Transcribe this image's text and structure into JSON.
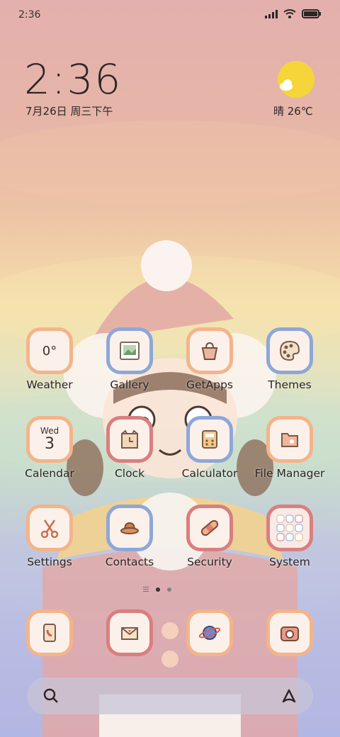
{
  "status_bar": {
    "time": "2:36"
  },
  "clock_widget": {
    "time": "2:36",
    "date": "7月26日 周三下午"
  },
  "weather_widget": {
    "text": "晴 26℃"
  },
  "apps": {
    "weather": {
      "label": "Weather",
      "value": "0°"
    },
    "gallery": {
      "label": "Gallery"
    },
    "getapps": {
      "label": "GetApps"
    },
    "themes": {
      "label": "Themes"
    },
    "calendar": {
      "label": "Calendar",
      "weekday": "Wed",
      "day": "3"
    },
    "clock": {
      "label": "Clock"
    },
    "calculator": {
      "label": "Calculator"
    },
    "file_manager": {
      "label": "File Manager"
    },
    "settings": {
      "label": "Settings"
    },
    "contacts": {
      "label": "Contacts"
    },
    "security": {
      "label": "Security"
    },
    "system": {
      "label": "System"
    }
  },
  "dock": [
    "phone-icon",
    "messages-icon",
    "browser-icon",
    "camera-icon"
  ],
  "page_indicator": {
    "pages": 2,
    "active": 1
  },
  "colors": {
    "tile_orange": "#f4b48a",
    "tile_blue": "#8ea7d8",
    "tile_red": "#d97f7f",
    "sun": "#f6d53a"
  }
}
